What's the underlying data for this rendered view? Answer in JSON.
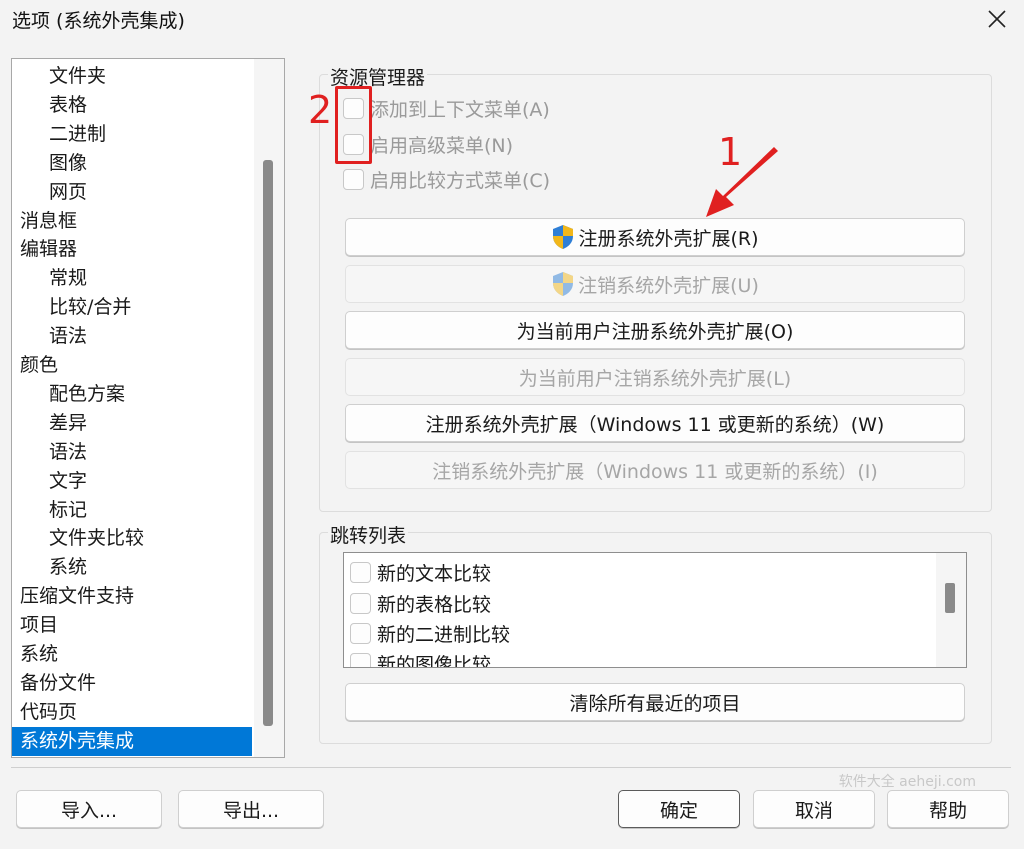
{
  "window": {
    "title": "选项 (系统外壳集成)"
  },
  "tree": {
    "items": [
      {
        "label": "文件夹",
        "level": 1
      },
      {
        "label": "表格",
        "level": 1
      },
      {
        "label": "二进制",
        "level": 1
      },
      {
        "label": "图像",
        "level": 1
      },
      {
        "label": "网页",
        "level": 1
      },
      {
        "label": "消息框",
        "level": 0
      },
      {
        "label": "编辑器",
        "level": 0
      },
      {
        "label": "常规",
        "level": 1
      },
      {
        "label": "比较/合并",
        "level": 1
      },
      {
        "label": "语法",
        "level": 1
      },
      {
        "label": "颜色",
        "level": 0
      },
      {
        "label": "配色方案",
        "level": 1
      },
      {
        "label": "差异",
        "level": 1
      },
      {
        "label": "语法",
        "level": 1
      },
      {
        "label": "文字",
        "level": 1
      },
      {
        "label": "标记",
        "level": 1
      },
      {
        "label": "文件夹比较",
        "level": 1
      },
      {
        "label": "系统",
        "level": 1
      },
      {
        "label": "压缩文件支持",
        "level": 0
      },
      {
        "label": "项目",
        "level": 0
      },
      {
        "label": "系统",
        "level": 0
      },
      {
        "label": "备份文件",
        "level": 0
      },
      {
        "label": "代码页",
        "level": 0
      },
      {
        "label": "系统外壳集成",
        "level": 0,
        "selected": true
      }
    ]
  },
  "explorer": {
    "title": "资源管理器",
    "checkboxes": [
      {
        "label": "添加到上下文菜单(A)",
        "checked": false
      },
      {
        "label": "启用高级菜单(N)",
        "checked": false
      },
      {
        "label": "启用比较方式菜单(C)",
        "checked": false
      }
    ],
    "buttons": {
      "register": "注册系统外壳扩展(R)",
      "unregister": "注销系统外壳扩展(U)",
      "register_user": "为当前用户注册系统外壳扩展(O)",
      "unregister_user": "为当前用户注销系统外壳扩展(L)",
      "register_win11": "注册系统外壳扩展（Windows 11 或更新的系统）(W)",
      "unregister_win11": "注销系统外壳扩展（Windows 11 或更新的系统）(I)"
    }
  },
  "jumplist": {
    "title": "跳转列表",
    "items": [
      {
        "label": "新的文本比较",
        "checked": false
      },
      {
        "label": "新的表格比较",
        "checked": false
      },
      {
        "label": "新的二进制比较",
        "checked": false
      },
      {
        "label": "新的图像比较",
        "checked": false
      }
    ],
    "clear_button": "清除所有最近的项目"
  },
  "footer": {
    "import": "导入...",
    "export": "导出...",
    "ok": "确定",
    "cancel": "取消",
    "help": "帮助"
  },
  "watermark": "软件大全 aeheji.com",
  "annotations": {
    "label_1": "1",
    "label_2": "2",
    "color": "#e02020"
  },
  "colors": {
    "accent": "#0078d7"
  }
}
